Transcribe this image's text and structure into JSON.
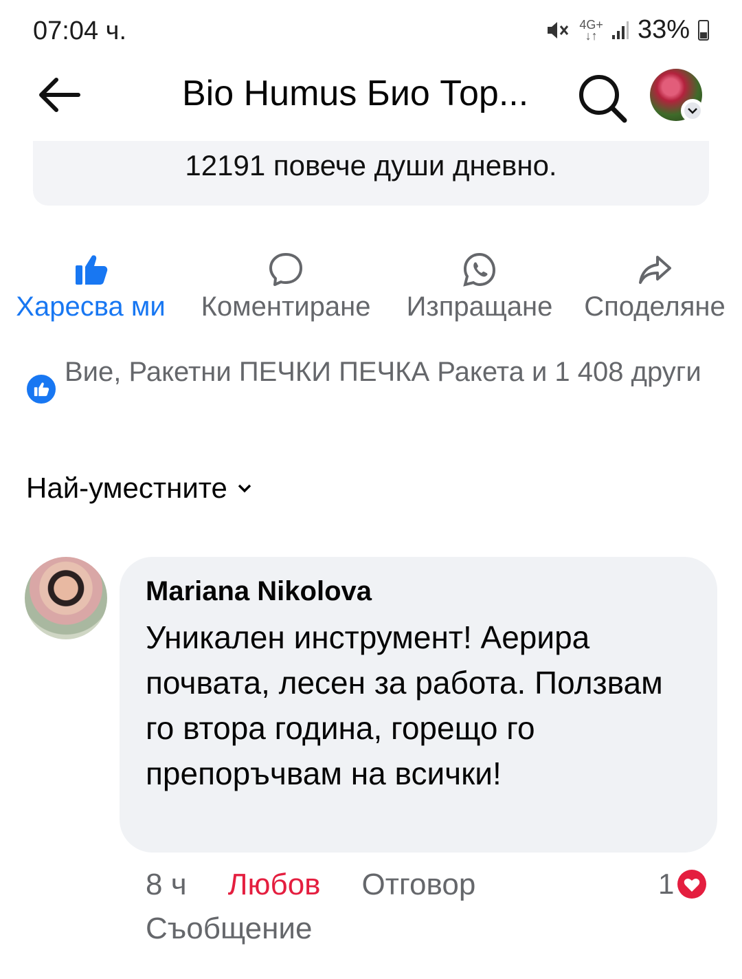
{
  "status_bar": {
    "time": "07:04 ч.",
    "network_top": "4G+",
    "network_bottom": "↓↑",
    "battery": "33%"
  },
  "header": {
    "title": "Bio Humus Био Тор..."
  },
  "post": {
    "text": "12191 повече души дневно."
  },
  "actions": [
    {
      "label": "Харесва ми",
      "active": true
    },
    {
      "label": "Коментиране"
    },
    {
      "label": "Изпращане"
    },
    {
      "label": "Споделяне"
    }
  ],
  "likes": {
    "text": "Вие, Ракетни ПЕЧКИ ПЕЧКА Ракета и 1 408 други"
  },
  "sort": {
    "label": "Най-уместните"
  },
  "comment": {
    "author": "Mariana Nikolova",
    "text": "Уникален инструмент! Аерира почвата, лесен за работа. Ползвам го втора година, горещо го препоръчвам на всички!",
    "time": "8 ч",
    "love": "Любов",
    "reply": "Отговор",
    "message": "Съобщение",
    "reaction_count": "1"
  },
  "colors": {
    "accent": "#1877f2",
    "love": "#e41e3f",
    "secondary_text": "#65676b",
    "bubble": "#f0f2f5"
  }
}
